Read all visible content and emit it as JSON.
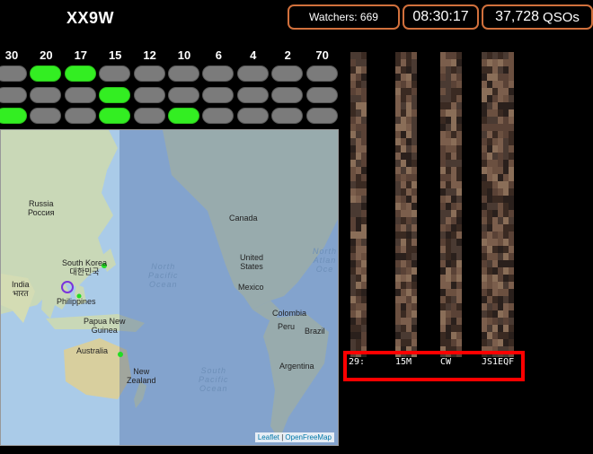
{
  "header": {
    "callsign": "XX9W",
    "watchers": "Watchers: 669",
    "clock": "08:30:17",
    "qso_count": "37,728",
    "qso_label": "QSOs"
  },
  "bands": [
    "30",
    "20",
    "17",
    "15",
    "12",
    "10",
    "6",
    "4",
    "2",
    "70"
  ],
  "band_grid_active": [
    [
      false,
      true,
      true,
      false,
      false,
      false,
      false,
      false,
      false,
      false
    ],
    [
      false,
      false,
      false,
      true,
      false,
      false,
      false,
      false,
      false,
      false
    ],
    [
      true,
      false,
      false,
      true,
      false,
      true,
      false,
      false,
      false,
      false
    ]
  ],
  "colors": {
    "accent_border": "#d1703c",
    "active_band": "#33ee22",
    "inactive_band": "#7b7b7b",
    "highlight": "#ff0000"
  },
  "map": {
    "labels": {
      "russia": "Russia",
      "russia_local": "Россия",
      "canada": "Canada",
      "south_korea": "South Korea",
      "korea_local": "대한민국",
      "india": "India",
      "india_local": "भारत",
      "philippines": "Philippines",
      "png": "Papua New",
      "png2": "Guinea",
      "australia": "Australia",
      "nz": "New",
      "nz2": "Zealand",
      "us": "United",
      "us2": "States",
      "mexico": "Mexico",
      "colombia": "Colombia",
      "peru": "Peru",
      "brazil": "Brazil",
      "argentina": "Argentina"
    },
    "oceans": {
      "npo1": "North",
      "npo2": "Pacific",
      "npo3": "Ocean",
      "spo1": "South",
      "spo2": "Pacific",
      "spo3": "Ocean",
      "nao1": "North",
      "nao2": "Atlan",
      "nao3": "Oce"
    },
    "attribution_leaflet": "Leaflet",
    "attribution_sep": " | ",
    "attribution_osm": "OpenFreeMap"
  },
  "decode": {
    "time": "29:",
    "band": "15M",
    "mode": "CW",
    "call": "JS1EQF"
  }
}
